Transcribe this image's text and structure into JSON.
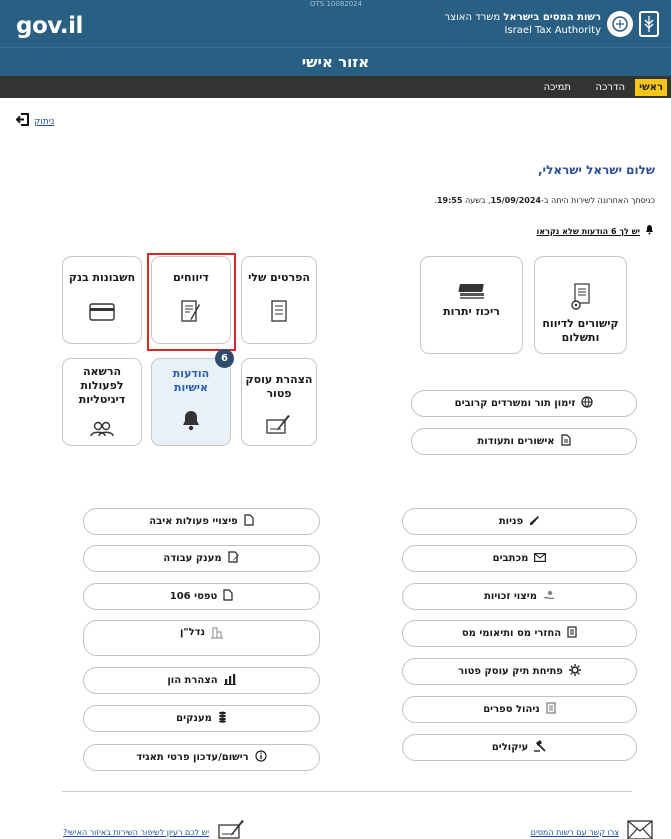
{
  "header": {
    "build_tag": "OTS 10082024",
    "logo": "gov.il",
    "authority_he_prefix": "רשות המסים בישראל",
    "authority_he_suffix": "משרד האוצר",
    "authority_en": "Israel Tax Authority",
    "page_title": "אזור אישי",
    "accent_color": "#2a5f84"
  },
  "nav": {
    "items": [
      {
        "label": "ראשי",
        "active": true
      },
      {
        "label": "הדרכה",
        "active": false
      },
      {
        "label": "תמיכה",
        "active": false
      }
    ],
    "active_color": "#f5c518"
  },
  "logout": {
    "label": "ניתוק",
    "icon": "logout-icon"
  },
  "greeting": {
    "hello": "שלום ישראל ישראלי,",
    "last_visit_prefix": "כניסתך האחרונה לשירות היתה ב-",
    "last_visit_date": "15/09/2024",
    "last_visit_mid": ", בשעה ",
    "last_visit_time": "19:55",
    "last_visit_end": ".",
    "unread_text": "יש לך 6 הודעות שלא נקראו"
  },
  "tiles_left": [
    {
      "label": "חשבונות בנק",
      "icon": "credit-card-icon"
    },
    {
      "label": "דיווחים",
      "icon": "report-edit-icon",
      "highlighted": true
    },
    {
      "label": "הפרטים שלי",
      "icon": "id-document-icon"
    },
    {
      "label": "הרשאה לפעולות דיגיטליות",
      "icon": "users-icon"
    },
    {
      "label": "הודעות אישיות",
      "icon": "bell-icon",
      "badge": "6"
    },
    {
      "label": "הצהרת עוסק פטור",
      "icon": "signature-icon"
    }
  ],
  "tiles_right": [
    {
      "label": "ריכוז יתרות",
      "icon": "money-stack-icon"
    },
    {
      "label": "קישורים לדיווח ותשלום",
      "icon": "document-gear-icon"
    }
  ],
  "right_pills": [
    {
      "label": "זימון תור ומשרדים קרובים",
      "icon": "globe-icon"
    },
    {
      "label": "אישורים ותעודות",
      "icon": "document-icon"
    }
  ],
  "bottom_right": [
    {
      "label": "פניות",
      "icon": "pen-icon"
    },
    {
      "label": "מכתבים",
      "icon": "envelope-icon"
    },
    {
      "label": "מיצוי זכויות",
      "icon": "hand-coin-icon"
    },
    {
      "label": "החזרי מס ותיאומי מס",
      "icon": "clipboard-icon"
    },
    {
      "label": "פתיחת תיק עוסק פטור",
      "icon": "gear-icon"
    },
    {
      "label": "ניהול ספרים",
      "icon": "ledger-icon"
    },
    {
      "label": "עיקולים",
      "icon": "gavel-icon"
    }
  ],
  "bottom_left": [
    {
      "label": "פיצויי פעולות איבה",
      "icon": "document-icon"
    },
    {
      "label": "מענק עבודה",
      "icon": "edit-document-icon"
    },
    {
      "label": "טפסי 106",
      "icon": "document-icon"
    },
    {
      "label": "נדל\"ן",
      "icon": "building-icon"
    },
    {
      "label": "הצהרת הון",
      "icon": "bar-chart-icon"
    },
    {
      "label": "מענקים",
      "icon": "coins-icon"
    },
    {
      "label": "רישום/עדכון פרטי תאגיד",
      "icon": "info-icon"
    }
  ],
  "footer": {
    "contact": "צרו קשר עם רשות המסים",
    "feedback": "יש לכם רעיון לשיפור השירות באיזור האישי?"
  }
}
